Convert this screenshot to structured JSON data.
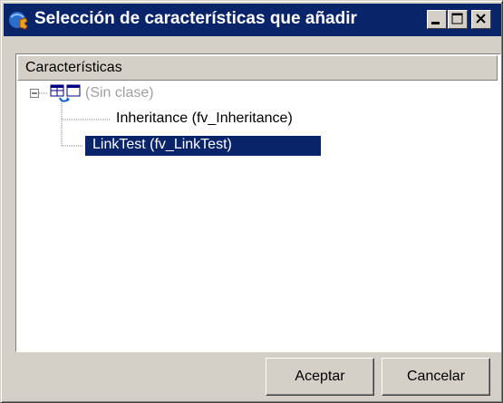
{
  "window": {
    "title": "Selección de características que añadir"
  },
  "tree": {
    "column_header": "Características",
    "root": {
      "label": "(Sin clase)",
      "icon": "class-table-icon",
      "expanded": true
    },
    "children": [
      {
        "label": "Inheritance (fv_Inheritance)",
        "selected": false
      },
      {
        "label": "LinkTest (fv_LinkTest)",
        "selected": true
      }
    ]
  },
  "buttons": {
    "ok": "Aceptar",
    "cancel": "Cancelar"
  },
  "colors": {
    "titlebar": "#0a246a",
    "face": "#d4d0c8",
    "selection": "#0a246a"
  }
}
